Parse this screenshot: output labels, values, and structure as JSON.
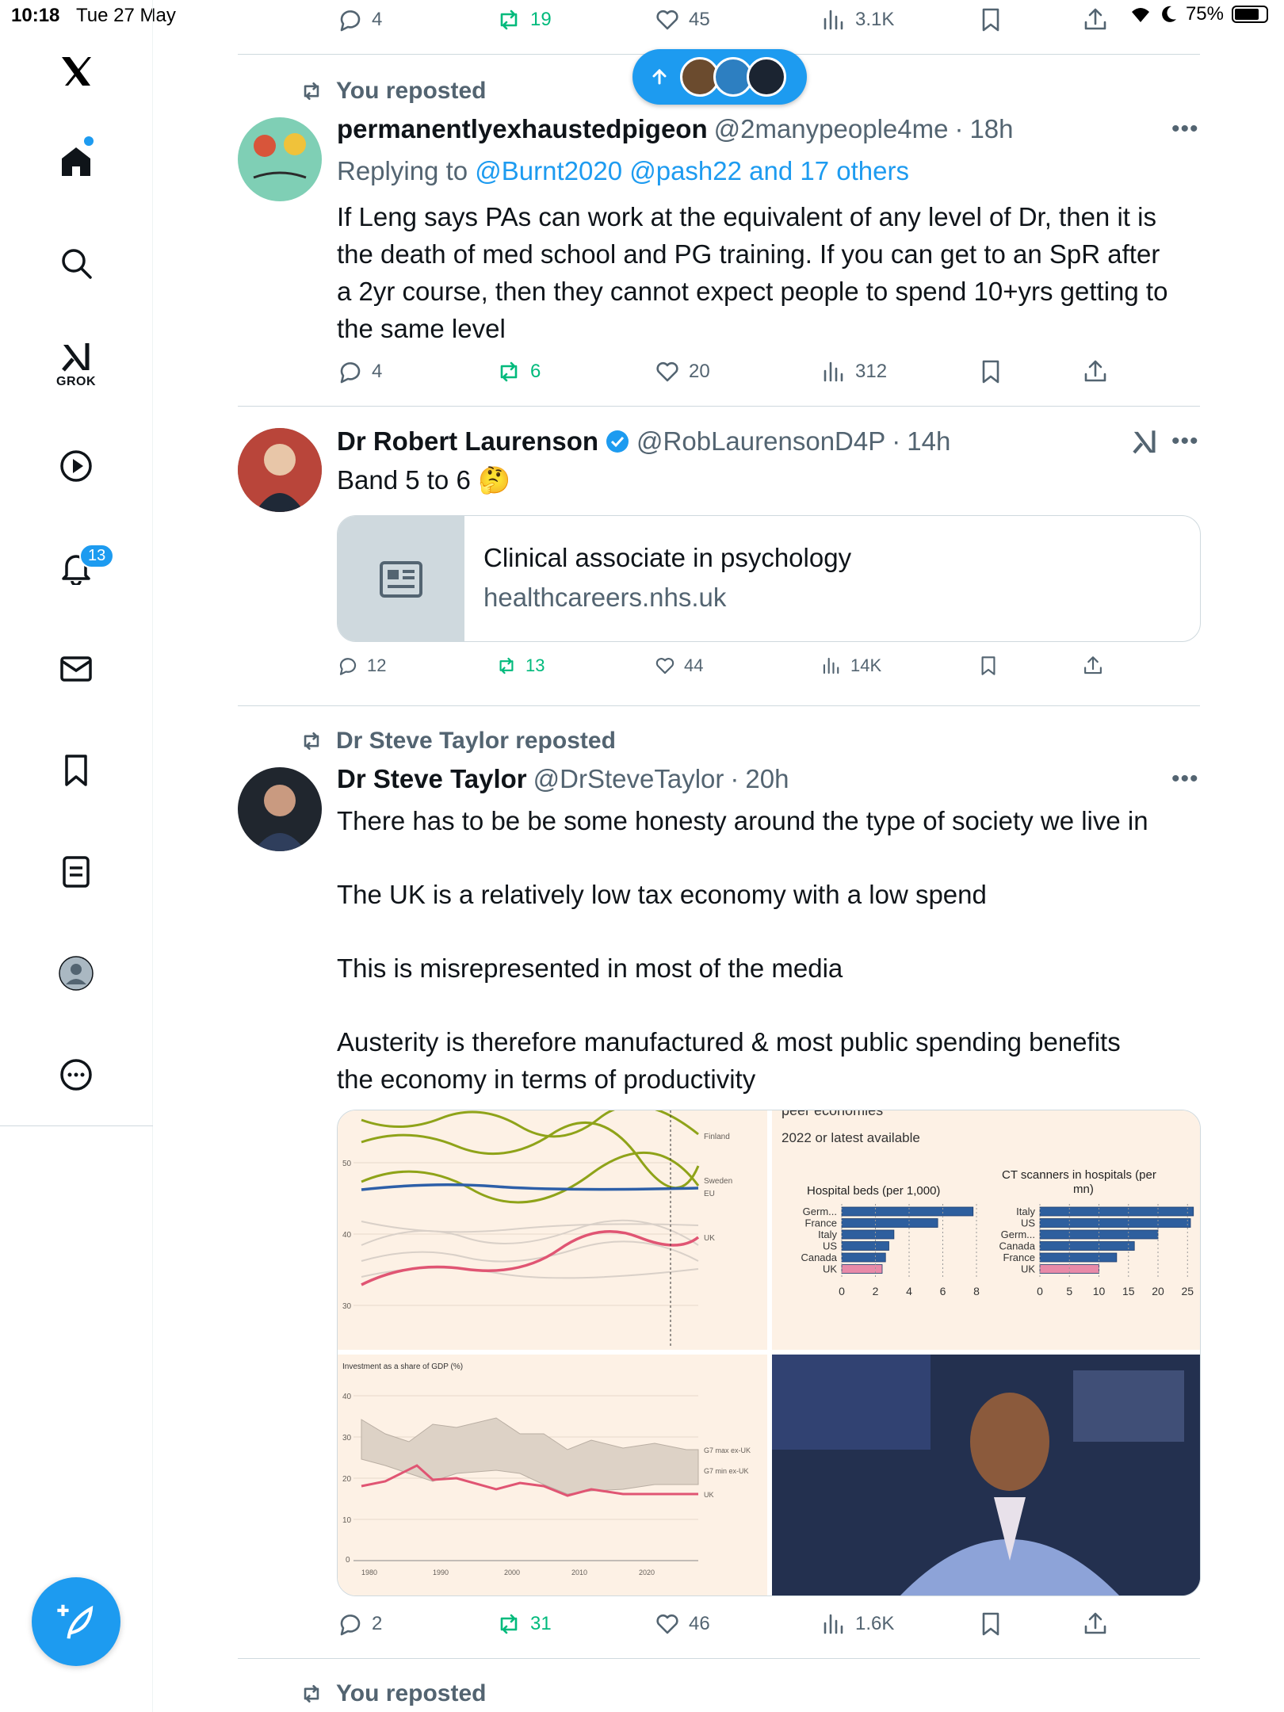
{
  "status_bar": {
    "time": "10:18",
    "date": "Tue 27 May",
    "battery": "75%"
  },
  "sidebar": {
    "grok_label": "GROK",
    "notifications_badge": "13",
    "items": [
      "home",
      "explore",
      "grok",
      "video",
      "notifications",
      "messages",
      "bookmarks",
      "lists",
      "profile",
      "more"
    ]
  },
  "top_actions": {
    "replies": "4",
    "reposts": "19",
    "likes": "45",
    "views": "3.1K"
  },
  "tweets": [
    {
      "repost_label": "You reposted",
      "name": "permanentlyexhaustedpigeon",
      "handle": "@2manypeople4me",
      "time": "18h",
      "reply_prefix": "Replying to ",
      "reply_targets": "@Burnt2020 @pash22 and 17 others",
      "lines": [
        "If Leng says PAs can work at the equivalent of any level of Dr, then it is",
        "the death of med school and PG training. If you can get to an SpR after",
        "a 2yr course, then they cannot expect people to spend 10+yrs getting to",
        "the same level"
      ],
      "replies": "4",
      "reposts": "6",
      "likes": "20",
      "views": "312"
    },
    {
      "name": "Dr Robert Laurenson",
      "handle": "@RobLaurensonD4P",
      "time": "14h",
      "text": "Band 5 to 6 🤔",
      "card_title": "Clinical associate in psychology",
      "card_domain": "healthcareers.nhs.uk",
      "replies": "12",
      "reposts": "13",
      "likes": "44",
      "views": "14K"
    },
    {
      "repost_label": "Dr Steve Taylor reposted",
      "name": "Dr Steve Taylor",
      "handle": "@DrSteveTaylor",
      "time": "20h",
      "paragraphs": [
        "There has to be be some honesty around the type of society we live in",
        "The UK is a relatively low tax economy with a low spend",
        "This is misrepresented in most of the media",
        "Austerity is therefore manufactured & most public spending benefits",
        "the economy in terms of productivity"
      ],
      "replies": "2",
      "reposts": "31",
      "likes": "46",
      "views": "1.6K"
    },
    {
      "repost_label": "You reposted"
    }
  ],
  "media": {
    "chart1": {
      "labels": [
        "Finland",
        "Sweden",
        "EU",
        "UK"
      ],
      "yticks": [
        "50",
        "40",
        "30"
      ]
    },
    "chart2": {
      "cut_title": "peer economies",
      "subtitle": "2022 or latest available",
      "left_title": "Hospital beds (per 1,000)",
      "left_categories": [
        "Germ...",
        "France",
        "Italy",
        "US",
        "Canada",
        "UK"
      ],
      "left_values": [
        7.8,
        5.7,
        3.1,
        2.8,
        2.6,
        2.4
      ],
      "left_ticks": [
        "0",
        "2",
        "4",
        "6",
        "8"
      ],
      "right_title_1": "CT scanners in hospitals (per",
      "right_title_2": "mn)",
      "right_categories": [
        "Italy",
        "US",
        "Germ...",
        "Canada",
        "France",
        "UK"
      ],
      "right_values": [
        26,
        25.5,
        20,
        16,
        13,
        10
      ],
      "right_ticks": [
        "0",
        "5",
        "10",
        "15",
        "20",
        "25"
      ]
    },
    "chart3": {
      "title": "Investment as a share of GDP (%)",
      "yticks": [
        "40",
        "30",
        "20",
        "10",
        "0"
      ],
      "xticks": [
        "1980",
        "1990",
        "2000",
        "2010",
        "2020"
      ],
      "labels": [
        "G7 max ex-UK",
        "G7 min ex-UK",
        "UK"
      ]
    }
  },
  "colors": {
    "accent": "#1d9bf0",
    "repost_green": "#00ba7c",
    "muted": "#536471",
    "chart_bg": "#fdf1e5",
    "bar_blue": "#2e5f9e",
    "bar_pink": "#e88aa8"
  }
}
